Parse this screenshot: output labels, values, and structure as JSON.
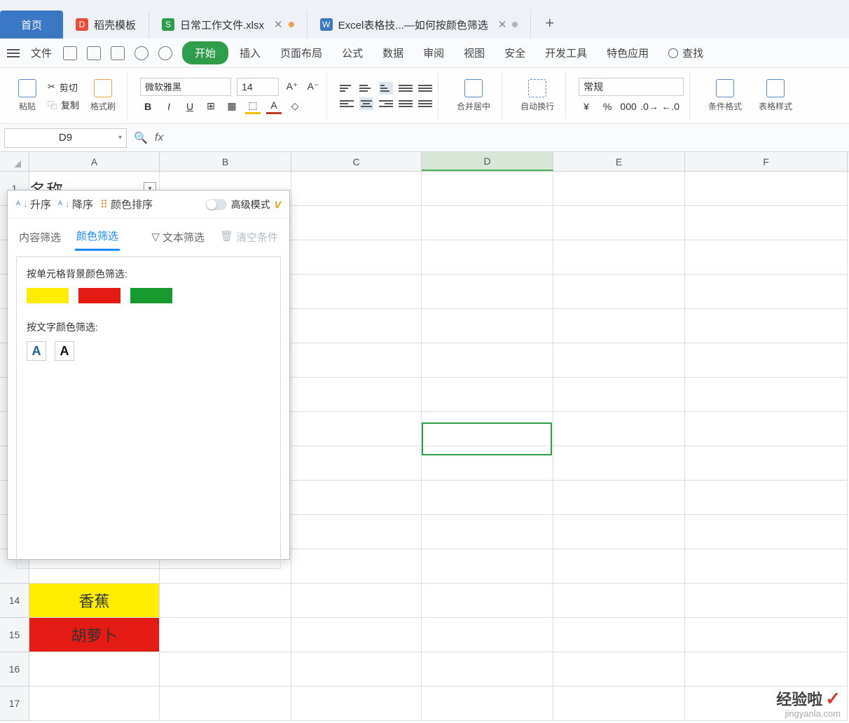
{
  "tabs": {
    "home": "首页",
    "t2": "稻壳模板",
    "t3": "日常工作文件.xlsx",
    "t4": "Excel表格技...—如何按颜色筛选"
  },
  "menu": {
    "file": "文件",
    "items": [
      "开始",
      "插入",
      "页面布局",
      "公式",
      "数据",
      "审阅",
      "视图",
      "安全",
      "开发工具",
      "特色应用"
    ],
    "search": "查找"
  },
  "ribbon": {
    "cut": "剪切",
    "copy": "复制",
    "paste": "粘贴",
    "formatpainter": "格式刷",
    "font_name": "微软雅黑",
    "font_size": "14",
    "merge": "合并居中",
    "wrap": "自动换行",
    "numfmt": "常规",
    "condfmt": "条件格式",
    "tablestyle": "表格样式"
  },
  "namebox": "D9",
  "cols": [
    "A",
    "B",
    "C",
    "D",
    "E",
    "F"
  ],
  "row1_header": "名称",
  "rows_visible_nums": [
    "1",
    "14",
    "15",
    "16",
    "17"
  ],
  "row14": "香蕉",
  "row15": "胡萝卜",
  "panel": {
    "asc": "升序",
    "desc": "降序",
    "colorsort": "颜色排序",
    "advmode": "高级模式",
    "tab_content": "内容筛选",
    "tab_color": "颜色筛选",
    "tab_text": "文本筛选",
    "tab_clear": "清空条件",
    "sect_fill": "按单元格背景颜色筛选:",
    "sect_font": "按文字颜色筛选:"
  },
  "watermark": {
    "name": "经验啦",
    "url": "jingyanla.com"
  }
}
